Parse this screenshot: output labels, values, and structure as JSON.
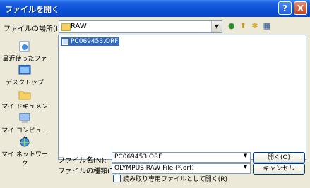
{
  "window": {
    "title": "ファイルを開く",
    "help": "?",
    "close": "X"
  },
  "lookin": {
    "label": "ファイルの場所(I):",
    "value": "RAW"
  },
  "places": [
    {
      "label": "最近使ったファイル"
    },
    {
      "label": "デスクトップ"
    },
    {
      "label": "マイ ドキュメント"
    },
    {
      "label": "マイ コンピュータ"
    },
    {
      "label": "マイ ネットワーク"
    }
  ],
  "files": [
    {
      "name": "PC069453.ORF"
    }
  ],
  "filename": {
    "label": "ファイル名(N):",
    "value": "PC069453.ORF"
  },
  "filetype": {
    "label": "ファイルの種類(T):",
    "value": "OLYMPUS RAW File (*.orf)"
  },
  "buttons": {
    "open": "開く(O)",
    "cancel": "キャンセル"
  },
  "readonly": {
    "label": "読み取り専用ファイルとして開く(R)"
  }
}
